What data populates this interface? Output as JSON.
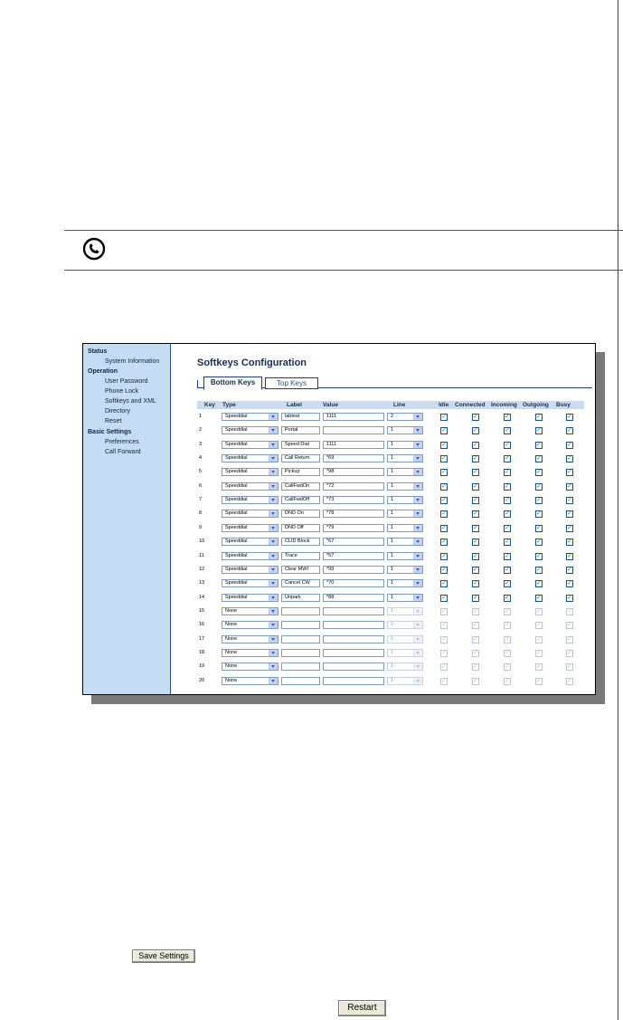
{
  "sidebar": {
    "items": [
      {
        "label": "Status",
        "level": 0
      },
      {
        "label": "System Information",
        "level": 1
      },
      {
        "label": "Operation",
        "level": 0
      },
      {
        "label": "User Password",
        "level": 1
      },
      {
        "label": "Phone Lock",
        "level": 1
      },
      {
        "label": "Softkeys and XML",
        "level": 1
      },
      {
        "label": "Directory",
        "level": 1
      },
      {
        "label": "Reset",
        "level": 1
      },
      {
        "label": "Basic Settings",
        "level": 0
      },
      {
        "label": "Preferences",
        "level": 1
      },
      {
        "label": "Call Forward",
        "level": 1
      }
    ]
  },
  "page": {
    "title": "Softkeys Configuration",
    "tabs": [
      "Bottom Keys",
      "Top Keys"
    ]
  },
  "table": {
    "columns": [
      "Key",
      "Type",
      "Label",
      "Value",
      "Line",
      "Idle",
      "Connected",
      "Incoming",
      "Outgoing",
      "Busy"
    ],
    "rows": [
      {
        "key": "1",
        "type": "Speeddial",
        "label": "labtest",
        "value": "1111",
        "line": "2",
        "checked": true
      },
      {
        "key": "2",
        "type": "Speeddial",
        "label": "Portal",
        "value": "",
        "line": "1",
        "checked": true
      },
      {
        "key": "3",
        "type": "Speeddial",
        "label": "Speed Dial",
        "value": "1111",
        "line": "1",
        "checked": true
      },
      {
        "key": "4",
        "type": "Speeddial",
        "label": "Call Return",
        "value": "*69",
        "line": "1",
        "checked": true
      },
      {
        "key": "5",
        "type": "Speeddial",
        "label": "Pickup",
        "value": "*98",
        "line": "1",
        "checked": true
      },
      {
        "key": "6",
        "type": "Speeddial",
        "label": "CallFwdOn",
        "value": "*72",
        "line": "1",
        "checked": true
      },
      {
        "key": "7",
        "type": "Speeddial",
        "label": "CallFwdOff",
        "value": "*73",
        "line": "1",
        "checked": true
      },
      {
        "key": "8",
        "type": "Speeddial",
        "label": "DND On",
        "value": "*78",
        "line": "1",
        "checked": true
      },
      {
        "key": "9",
        "type": "Speeddial",
        "label": "DND Off",
        "value": "*79",
        "line": "1",
        "checked": true
      },
      {
        "key": "10",
        "type": "Speeddial",
        "label": "CLID Block",
        "value": "*67",
        "line": "1",
        "checked": true
      },
      {
        "key": "11",
        "type": "Speeddial",
        "label": "Trace",
        "value": "*57",
        "line": "1",
        "checked": true
      },
      {
        "key": "12",
        "type": "Speeddial",
        "label": "Clear MWI",
        "value": "*99",
        "line": "1",
        "checked": true
      },
      {
        "key": "13",
        "type": "Speeddial",
        "label": "Cancel CW",
        "value": "*70",
        "line": "1",
        "checked": true
      },
      {
        "key": "14",
        "type": "Speeddial",
        "label": "Unpark",
        "value": "*88",
        "line": "1",
        "checked": true
      },
      {
        "key": "15",
        "type": "None",
        "label": "",
        "value": "",
        "line": "1",
        "checked": false
      },
      {
        "key": "16",
        "type": "None",
        "label": "",
        "value": "",
        "line": "1",
        "checked": false
      },
      {
        "key": "17",
        "type": "None",
        "label": "",
        "value": "",
        "line": "1",
        "checked": false
      },
      {
        "key": "18",
        "type": "None",
        "label": "",
        "value": "",
        "line": "1",
        "checked": false
      },
      {
        "key": "19",
        "type": "None",
        "label": "",
        "value": "",
        "line": "1",
        "checked": false
      },
      {
        "key": "20",
        "type": "None",
        "label": "",
        "value": "",
        "line": "1",
        "checked": false
      }
    ]
  },
  "buttons": {
    "save": "Save Settings",
    "restart": "Restart"
  },
  "icons": {
    "note": "phone-note-icon",
    "checkmark": "✓"
  }
}
